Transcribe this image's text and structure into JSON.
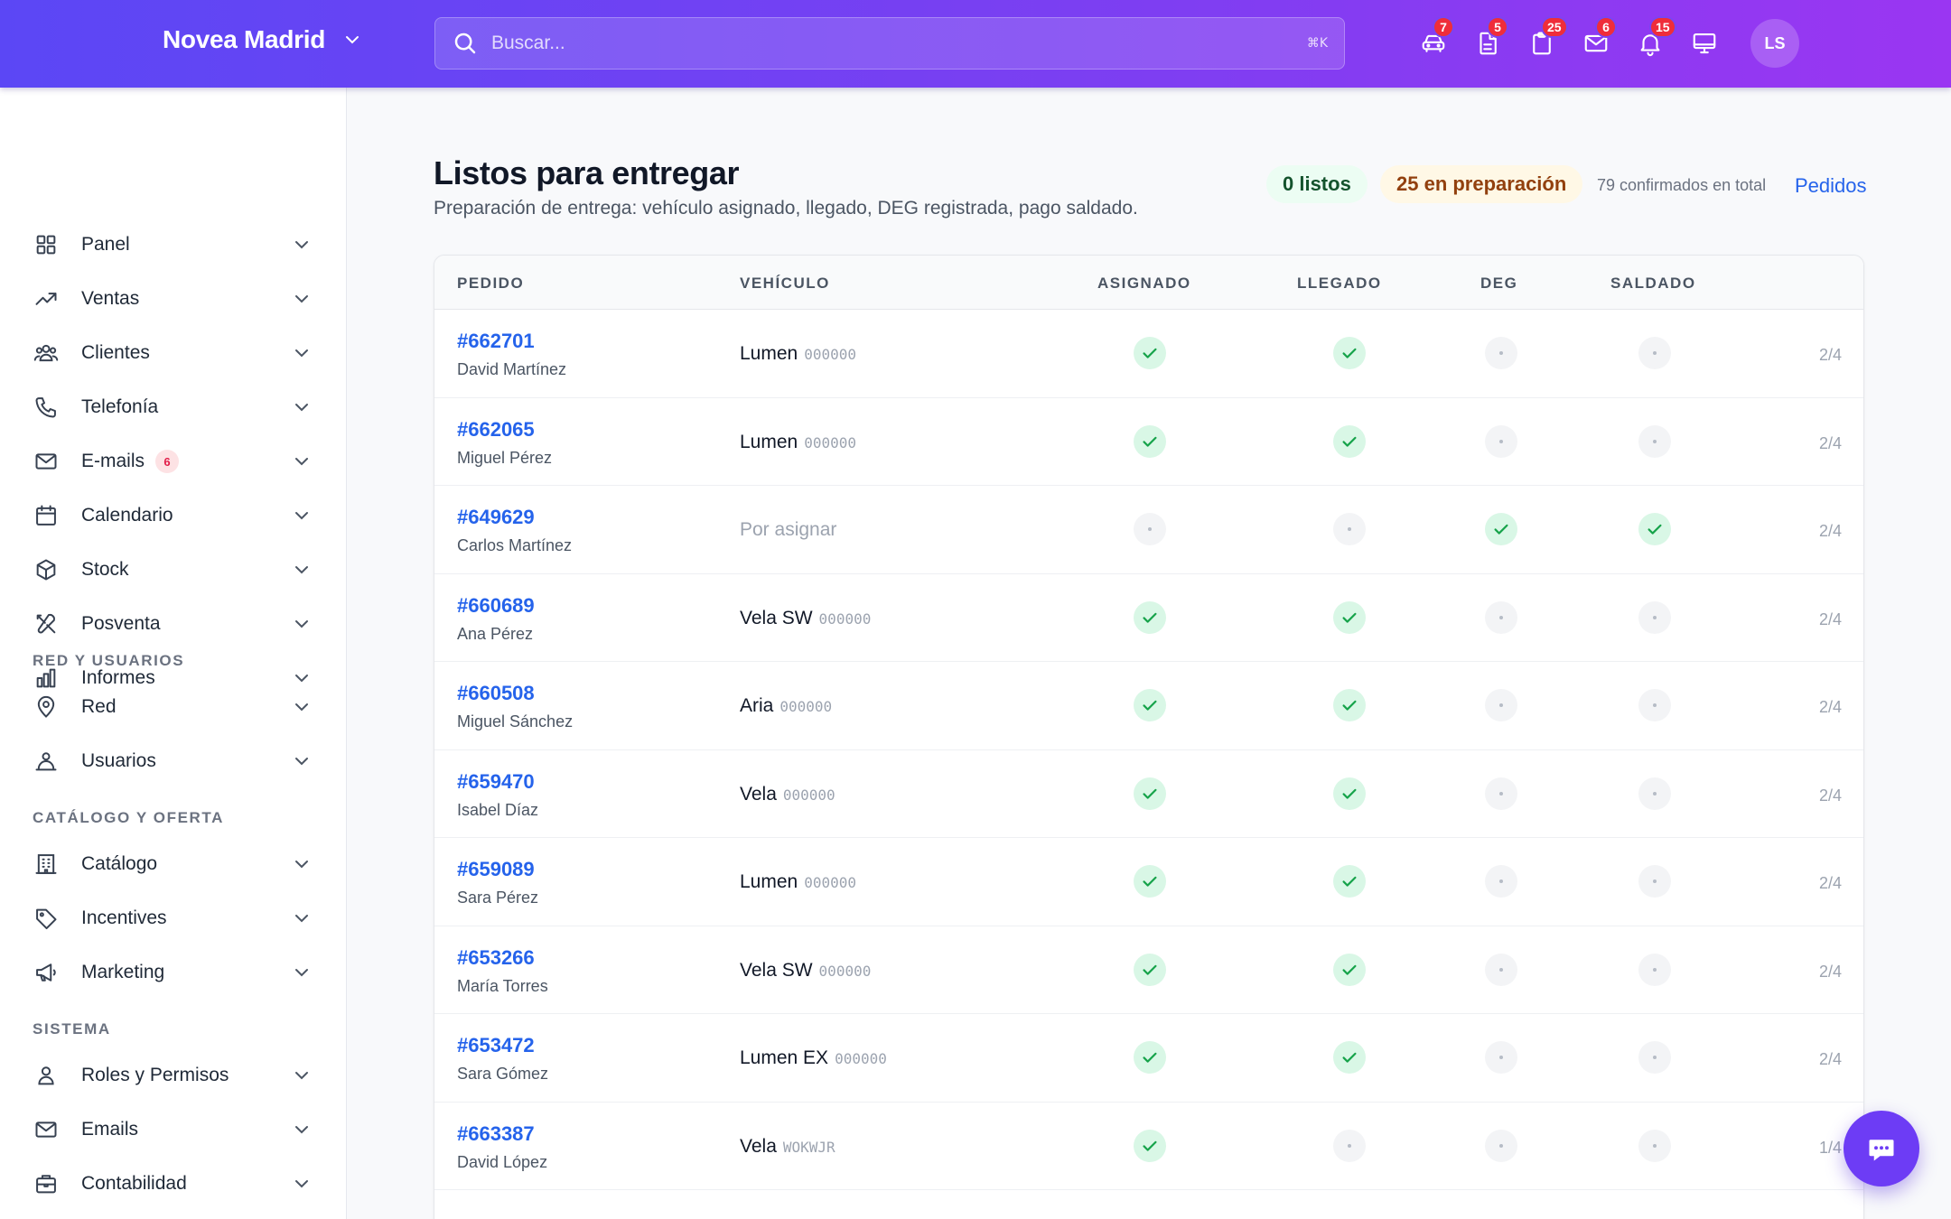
{
  "header": {
    "brand": "Novea Madrid",
    "search_placeholder": "Buscar...",
    "search_shortcut": "⌘K",
    "icons": [
      {
        "name": "car-icon",
        "badge": "7"
      },
      {
        "name": "document-icon",
        "badge": "5"
      },
      {
        "name": "clipboard-icon",
        "badge": "25"
      },
      {
        "name": "mail-icon",
        "badge": "6"
      },
      {
        "name": "bell-icon",
        "badge": "15"
      },
      {
        "name": "monitor-icon",
        "badge": ""
      }
    ],
    "avatar": "LS"
  },
  "sidebar": {
    "main_items": [
      {
        "label": "Panel",
        "icon": "grid-icon"
      },
      {
        "label": "Ventas",
        "icon": "trending-up-icon"
      },
      {
        "label": "Clientes",
        "icon": "users-icon"
      },
      {
        "label": "Telefonía",
        "icon": "phone-icon"
      },
      {
        "label": "E-mails",
        "icon": "mail-icon",
        "badge": "6"
      },
      {
        "label": "Calendario",
        "icon": "calendar-icon"
      },
      {
        "label": "Stock",
        "icon": "box-icon"
      },
      {
        "label": "Posventa",
        "icon": "tools-icon"
      },
      {
        "label": "Informes",
        "icon": "bar-chart-icon"
      }
    ],
    "section_red": "RED Y USUARIOS",
    "red_items": [
      {
        "label": "Red",
        "icon": "location-pin-icon"
      },
      {
        "label": "Usuarios",
        "icon": "user-group-icon"
      }
    ],
    "section_catalogo": "CATÁLOGO Y OFERTA",
    "catalogo_items": [
      {
        "label": "Catálogo",
        "icon": "building-icon"
      },
      {
        "label": "Incentives",
        "icon": "tag-icon"
      },
      {
        "label": "Marketing",
        "icon": "megaphone-icon"
      }
    ],
    "section_sistema": "SISTEMA",
    "sistema_items": [
      {
        "label": "Roles y Permisos",
        "icon": "user-icon"
      },
      {
        "label": "Emails",
        "icon": "mail-icon"
      },
      {
        "label": "Contabilidad",
        "icon": "briefcase-icon"
      }
    ]
  },
  "main": {
    "title": "Listos para entregar",
    "subtitle": "Preparación de entrega: vehículo asignado, llegado, DEG registrada, pago saldado.",
    "ready_pill": "0 listos",
    "prep_pill": "25 en preparación",
    "total_text": "79 confirmados en total",
    "link": "Pedidos",
    "columns": [
      "PEDIDO",
      "VEHÍCULO",
      "ASIGNADO",
      "LLEGADO",
      "DEG",
      "SALDADO"
    ],
    "rows": [
      {
        "id": "#662701",
        "customer": "David Martínez",
        "vehicle": "Lumen",
        "vin": "000000",
        "asignado": true,
        "llegado": true,
        "deg": false,
        "saldado": false,
        "progress": "2/4"
      },
      {
        "id": "#662065",
        "customer": "Miguel Pérez",
        "vehicle": "Lumen",
        "vin": "000000",
        "asignado": true,
        "llegado": true,
        "deg": false,
        "saldado": false,
        "progress": "2/4"
      },
      {
        "id": "#649629",
        "customer": "Carlos Martínez",
        "vehicle": "Por asignar",
        "vin": "",
        "asignado": false,
        "llegado": false,
        "deg": true,
        "saldado": true,
        "progress": "2/4"
      },
      {
        "id": "#660689",
        "customer": "Ana Pérez",
        "vehicle": "Vela SW",
        "vin": "000000",
        "asignado": true,
        "llegado": true,
        "deg": false,
        "saldado": false,
        "progress": "2/4"
      },
      {
        "id": "#660508",
        "customer": "Miguel Sánchez",
        "vehicle": "Aria",
        "vin": "000000",
        "asignado": true,
        "llegado": true,
        "deg": false,
        "saldado": false,
        "progress": "2/4"
      },
      {
        "id": "#659470",
        "customer": "Isabel Díaz",
        "vehicle": "Vela",
        "vin": "000000",
        "asignado": true,
        "llegado": true,
        "deg": false,
        "saldado": false,
        "progress": "2/4"
      },
      {
        "id": "#659089",
        "customer": "Sara Pérez",
        "vehicle": "Lumen",
        "vin": "000000",
        "asignado": true,
        "llegado": true,
        "deg": false,
        "saldado": false,
        "progress": "2/4"
      },
      {
        "id": "#653266",
        "customer": "María Torres",
        "vehicle": "Vela SW",
        "vin": "000000",
        "asignado": true,
        "llegado": true,
        "deg": false,
        "saldado": false,
        "progress": "2/4"
      },
      {
        "id": "#653472",
        "customer": "Sara Gómez",
        "vehicle": "Lumen EX",
        "vin": "000000",
        "asignado": true,
        "llegado": true,
        "deg": false,
        "saldado": false,
        "progress": "2/4"
      },
      {
        "id": "#663387",
        "customer": "David López",
        "vehicle": "Vela",
        "vin": "WOKWJR",
        "asignado": true,
        "llegado": false,
        "deg": false,
        "saldado": false,
        "progress": "1/4"
      }
    ]
  },
  "colors": {
    "accent": "#6d3cf5",
    "link": "#2563eb",
    "check_bg": "#d9f7e6",
    "check": "#16a34a",
    "badge": "#ef2d3a"
  }
}
